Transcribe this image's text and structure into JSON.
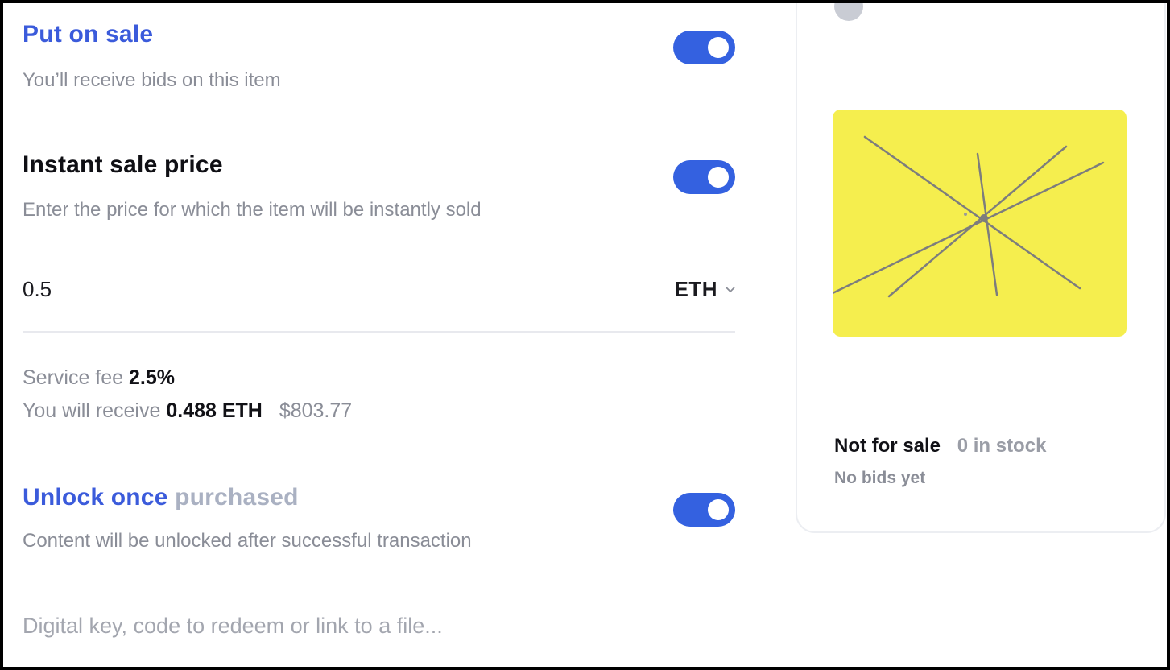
{
  "put_on_sale": {
    "title": "Put on sale",
    "subtitle": "You’ll receive bids on this item",
    "enabled": true
  },
  "instant_sale": {
    "title": "Instant sale price",
    "subtitle": "Enter the price for which the item will be instantly sold",
    "enabled": true,
    "price_value": "0.5",
    "currency": "ETH"
  },
  "fees": {
    "service_fee_label": "Service fee",
    "service_fee_value": "2.5%",
    "receive_label": "You will receive",
    "receive_value": "0.488 ETH",
    "receive_usd": "$803.77"
  },
  "unlock": {
    "title_part1": "Unlock once",
    "title_part2": "purchased",
    "subtitle": "Content will be unlocked after successful transaction",
    "enabled": true,
    "placeholder": "Digital key, code to redeem or link to a file..."
  },
  "preview_card": {
    "avatar_text": "",
    "status": "Not for sale",
    "stock": "0 in stock",
    "bids": "No bids yet",
    "image_bg_color": "#f5ee4e"
  },
  "colors": {
    "accent": "#3461e0",
    "title_blue": "#3b5bdb"
  }
}
